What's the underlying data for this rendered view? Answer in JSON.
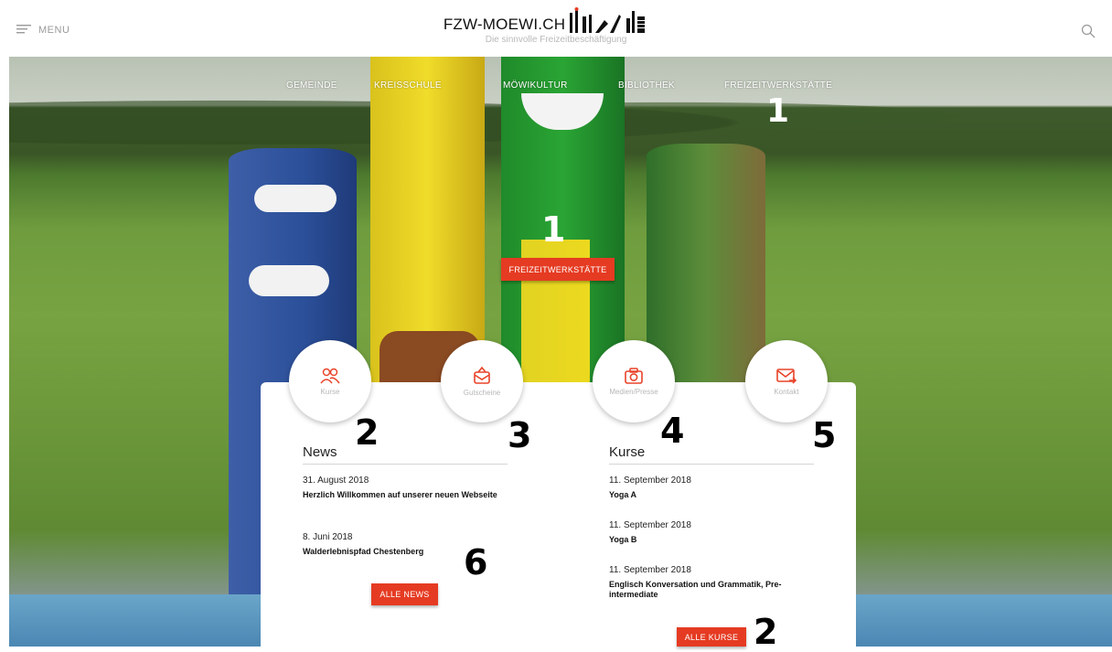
{
  "header": {
    "menu_label": "MENU",
    "logo_title": "FZW-MOEWI.CH",
    "logo_tagline": "Die sinnvolle Freizeitbeschäftigung"
  },
  "nav": {
    "items": [
      "GEMEINDE",
      "KREISSCHULE",
      "MÖWIKULTUR",
      "BIBLIOTHEK",
      "FREIZEITWERKSTÄTTE"
    ]
  },
  "hero": {
    "cta_label": "FREIZEITWERKSTÄTTE"
  },
  "quicklinks": [
    {
      "label": "Kurse",
      "icon": "users-icon"
    },
    {
      "label": "Gutscheine",
      "icon": "gift-icon"
    },
    {
      "label": "Medien/Presse",
      "icon": "camera-icon"
    },
    {
      "label": "Kontakt",
      "icon": "mail-icon"
    }
  ],
  "news": {
    "heading": "News",
    "items": [
      {
        "date": "31. August 2018",
        "title": "Herzlich Willkommen auf unserer neuen Webseite"
      },
      {
        "date": "8. Juni 2018",
        "title": "Walderlebnispfad Chestenberg"
      }
    ],
    "all_label": "ALLE NEWS"
  },
  "kurse": {
    "heading": "Kurse",
    "items": [
      {
        "date": "11. September 2018",
        "title": "Yoga A"
      },
      {
        "date": "11. September 2018",
        "title": "Yoga B"
      },
      {
        "date": "11. September 2018",
        "title": "Englisch Konversation und Grammatik, Pre-intermediate"
      }
    ],
    "all_label": "ALLE KURSE"
  },
  "annotations": {
    "nav_marker": "1",
    "cta_marker": "1",
    "kurse_marker": "2",
    "gutscheine_marker": "3",
    "medien_marker": "4",
    "kontakt_marker": "5",
    "news_marker": "6",
    "alle_kurse_marker": "2"
  },
  "colors": {
    "accent_red": "#e53b22",
    "icon_red": "#e8442a"
  }
}
